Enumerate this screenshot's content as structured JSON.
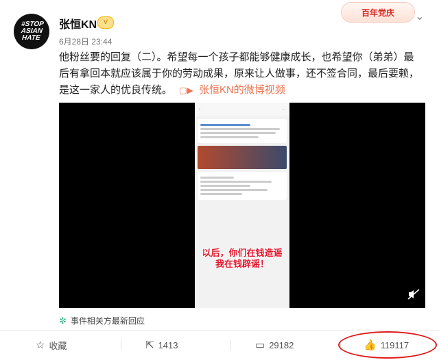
{
  "post": {
    "username": "张恒KN",
    "badge_label": "V",
    "datetime": "6月28日 23:44",
    "avatar_text": [
      "#STOP",
      "ASIAN",
      "HATE"
    ],
    "anniversary_badge": "百年党庆",
    "text": "他粉丝要的回复（二）。希望每一个孩子都能够健康成长，也希望你（弟弟）最后有拿回本就应该属于你的劳动成果，原来让人做事，还不签合同，最后要赖，是这一家人的优良传统。",
    "video_link_label": "张恒KN的微博视频"
  },
  "video": {
    "overlay_text": [
      "以后，你们在钱造谣",
      "我在钱辟谣！"
    ]
  },
  "event_link": {
    "label": "事件相关方最新回应"
  },
  "actions": {
    "favorite_label": "收藏",
    "repost_count": "1413",
    "comment_count": "29182",
    "like_count": "119117"
  },
  "colors": {
    "accent": "#eb7350",
    "highlight_circle": "#e01a1a"
  }
}
